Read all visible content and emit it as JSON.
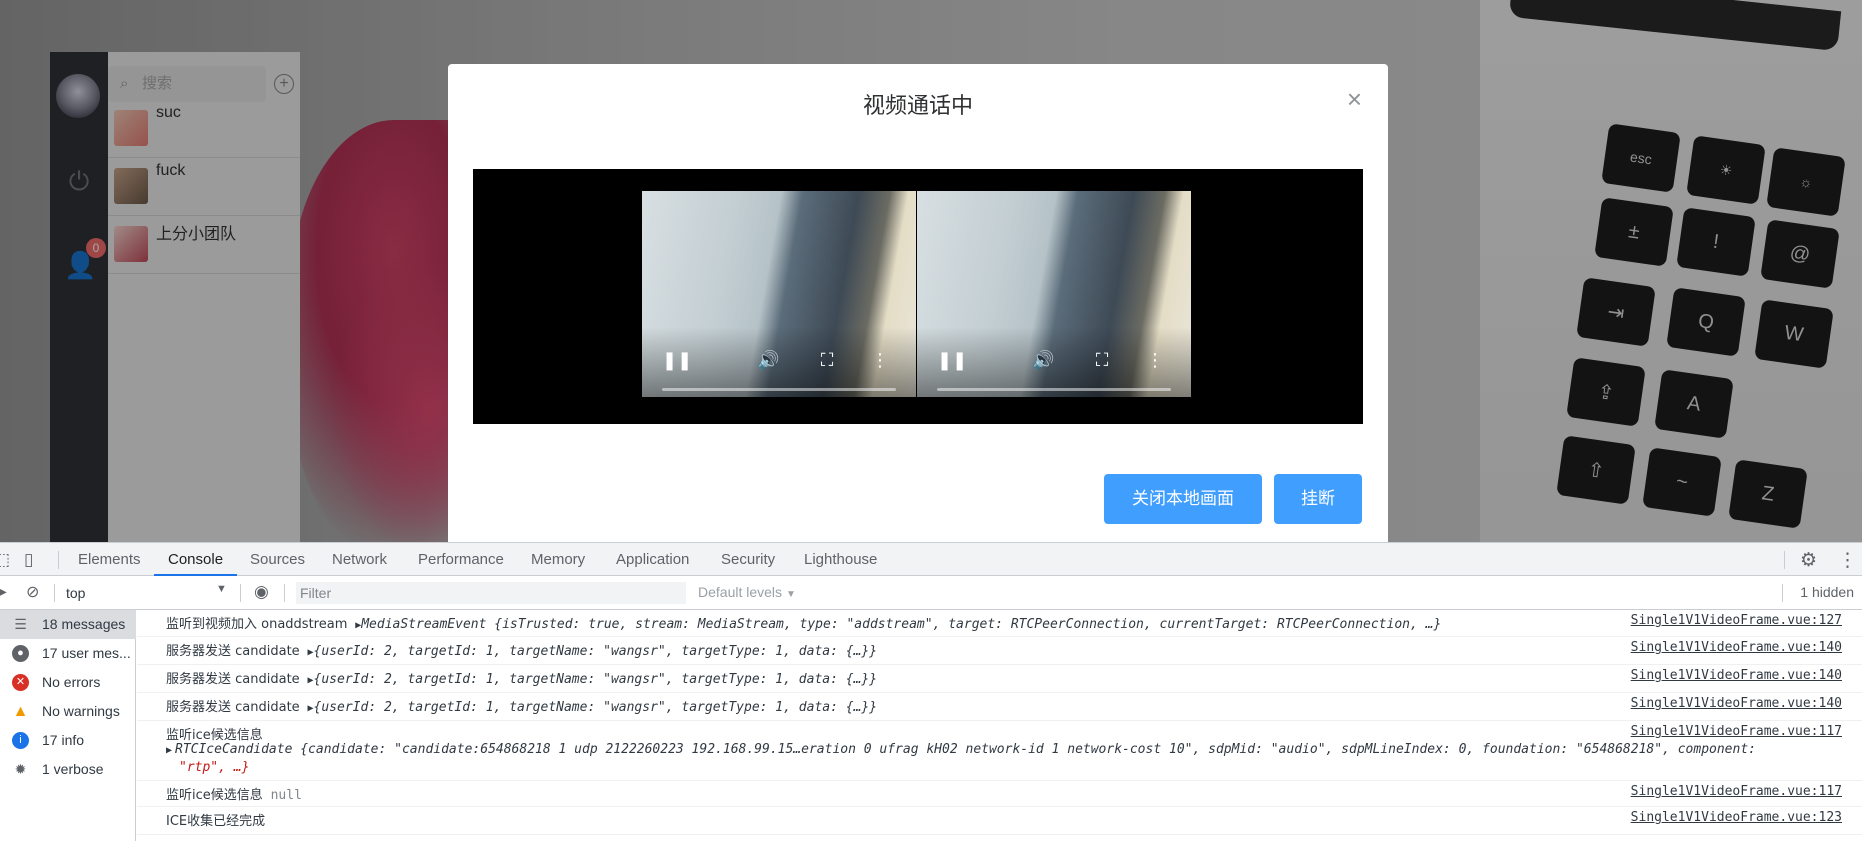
{
  "app": {
    "search_placeholder": "搜索",
    "add_icon": "plus-circle-icon",
    "badge_count": "0",
    "contacts": [
      {
        "name": "suc"
      },
      {
        "name": "fuck"
      },
      {
        "name": "上分小团队"
      }
    ]
  },
  "modal": {
    "title": "视频通话中",
    "close_glyph": "×",
    "close_local_label": "关闭本地画面",
    "hangup_label": "挂断"
  },
  "devtools": {
    "tabs": [
      "Elements",
      "Console",
      "Sources",
      "Network",
      "Performance",
      "Memory",
      "Application",
      "Security",
      "Lighthouse"
    ],
    "active_tab": "Console",
    "context": "top",
    "filter_placeholder": "Filter",
    "levels_label": "Default levels",
    "hidden_count": "1 hidden",
    "sidebar": [
      {
        "label": "18 messages",
        "icon": "list-icon"
      },
      {
        "label": "17 user mes...",
        "icon": "user-icon"
      },
      {
        "label": "No errors",
        "icon": "error-icon"
      },
      {
        "label": "No warnings",
        "icon": "warning-icon"
      },
      {
        "label": "17 info",
        "icon": "info-icon"
      },
      {
        "label": "1 verbose",
        "icon": "bug-icon"
      }
    ],
    "logs": {
      "l1_text": "监听到视频加入 onaddstream",
      "l1_src": "Single1V1VideoFrame.vue:127",
      "l2_text": "服务器发送 candidate",
      "l2_src": "Single1V1VideoFrame.vue:140",
      "l3_text": "服务器发送 candidate",
      "l3_src": "Single1V1VideoFrame.vue:140",
      "l4_text": "服务器发送 candidate",
      "l4_src": "Single1V1VideoFrame.vue:140",
      "l5_text": "监听ice候选信息",
      "l5_src": "Single1V1VideoFrame.vue:117",
      "l6_text": "监听ice候选信息",
      "l6_null": "null",
      "l6_src": "Single1V1VideoFrame.vue:117",
      "l7_text": "ICE收集已经完成",
      "l7_src": "Single1V1VideoFrame.vue:123",
      "candidate_obj": "{userId: 2, targetId: 1, targetName: \"wangsr\", targetType: 1, data: {…}}",
      "stream_event": "MediaStreamEvent {isTrusted: true, stream: MediaStream, type: \"addstream\", target: RTCPeerConnection, currentTarget: RTCPeerConnection, …}",
      "ice_line1": "RTCIceCandidate {candidate: \"candidate:654868218 1 udp 2122260223 192.168.99.15…eration 0 ufrag kH02 network-id 1 network-cost 10\", sdpMid: \"audio\", sdpMLineIndex: 0, foundation: \"654868218\", component:",
      "ice_line2": "\"rtp\", …}"
    }
  }
}
